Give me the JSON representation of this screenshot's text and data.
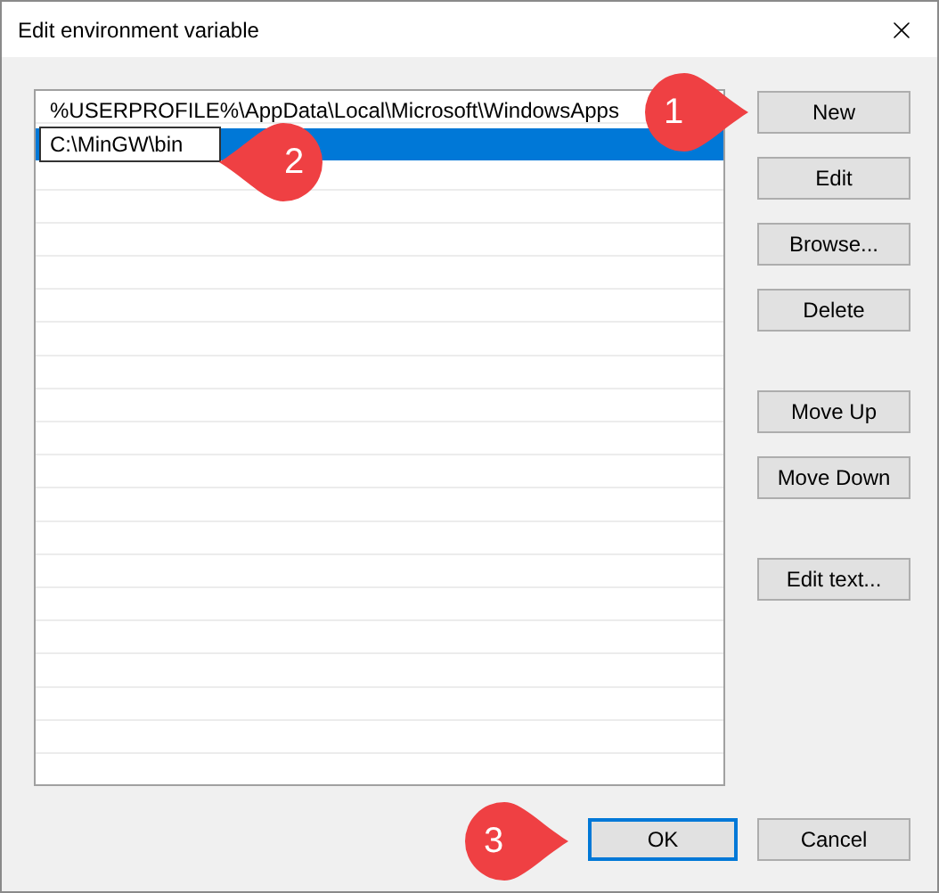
{
  "window": {
    "title": "Edit environment variable"
  },
  "entries": [
    {
      "text": "%USERPROFILE%\\AppData\\Local\\Microsoft\\WindowsApps",
      "selected": false,
      "editing": false
    },
    {
      "text": "C:\\MinGW\\bin",
      "selected": true,
      "editing": true
    }
  ],
  "side_buttons": [
    {
      "label": "New"
    },
    {
      "label": "Edit"
    },
    {
      "label": "Browse..."
    },
    {
      "label": "Delete"
    },
    {
      "label": "Move Up"
    },
    {
      "label": "Move Down"
    },
    {
      "label": "Edit text..."
    }
  ],
  "footer_buttons": [
    {
      "label": "OK",
      "default": true
    },
    {
      "label": "Cancel",
      "default": false
    }
  ],
  "callouts": [
    {
      "number": "1"
    },
    {
      "number": "2"
    },
    {
      "number": "3"
    }
  ]
}
